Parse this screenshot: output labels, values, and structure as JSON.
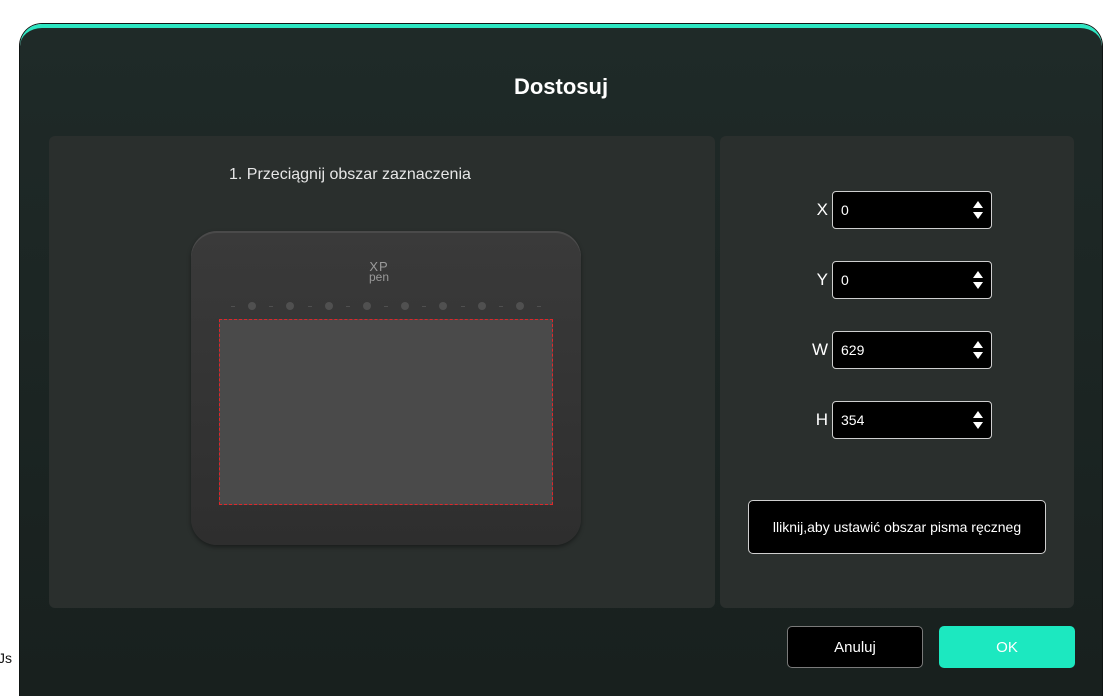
{
  "background": {
    "left_fragment_text": "Js"
  },
  "dialog": {
    "title": "Dostosuj",
    "accent_color": "#2ce6c2",
    "left_panel": {
      "instruction": "1. Przeciągnij obszar zaznaczenia",
      "tablet_logo_top": "XP",
      "tablet_logo_bottom": "pen",
      "active_area_border_color": "#e0262a"
    },
    "fields": [
      {
        "label": "X",
        "value": "0"
      },
      {
        "label": "Y",
        "value": "0"
      },
      {
        "label": "W",
        "value": "629"
      },
      {
        "label": "H",
        "value": "354"
      }
    ],
    "handwriting_button_label": "lliknij,aby ustawić obszar pisma ręczneg",
    "buttons": {
      "cancel_label": "Anuluj",
      "ok_label": "OK",
      "ok_color": "#1ce8c0"
    },
    "icons": {
      "spinner": "spinner-arrows-icon",
      "logo": "xp-pen-logo"
    }
  }
}
